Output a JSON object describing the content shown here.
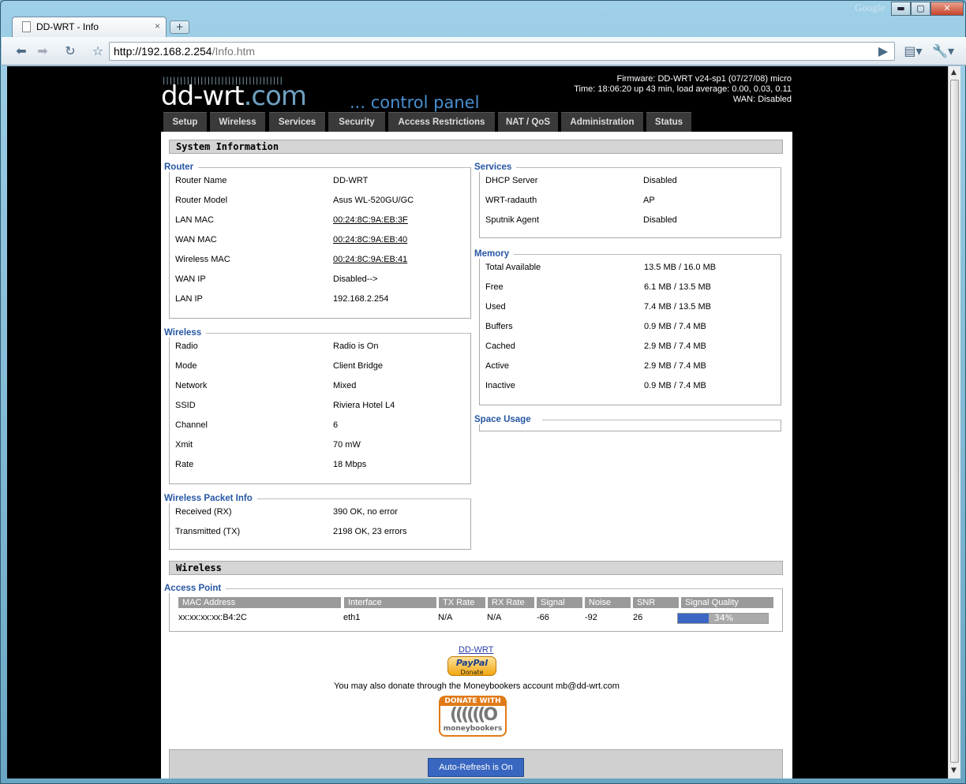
{
  "browser": {
    "tab_title": "DD-WRT - Info",
    "tab_close": "×",
    "new_tab": "+",
    "brand": "Google",
    "url_host": "http://192.168.2.254",
    "url_path": "/Info.htm"
  },
  "header": {
    "logo_main": "dd-wrt",
    "logo_suffix": ".com",
    "control_panel": "... control panel",
    "firmware": "Firmware: DD-WRT v24-sp1 (07/27/08) micro",
    "time": "Time: 18:06:20 up 43 min, load average: 0.00, 0.03, 0.11",
    "wan": "WAN: Disabled"
  },
  "nav": [
    "Setup",
    "Wireless",
    "Services",
    "Security",
    "Access Restrictions",
    "NAT / QoS",
    "Administration",
    "Status"
  ],
  "system_info_title": "System Information",
  "router": {
    "legend": "Router",
    "rows": [
      {
        "label": "Router Name",
        "value": "DD-WRT"
      },
      {
        "label": "Router Model",
        "value": "Asus WL-520GU/GC"
      },
      {
        "label": "LAN MAC",
        "value": "00:24:8C:9A:EB:3F"
      },
      {
        "label": "WAN MAC",
        "value": "00:24:8C:9A:EB:40"
      },
      {
        "label": "Wireless MAC",
        "value": "00:24:8C:9A:EB:41"
      },
      {
        "label": "WAN IP",
        "value": "Disabled-->"
      },
      {
        "label": "LAN IP",
        "value": "192.168.2.254"
      }
    ]
  },
  "wireless": {
    "legend": "Wireless",
    "rows": [
      {
        "label": "Radio",
        "value": "Radio is On"
      },
      {
        "label": "Mode",
        "value": "Client Bridge"
      },
      {
        "label": "Network",
        "value": "Mixed"
      },
      {
        "label": "SSID",
        "value": "Riviera Hotel L4"
      },
      {
        "label": "Channel",
        "value": "6"
      },
      {
        "label": "Xmit",
        "value": "70 mW"
      },
      {
        "label": "Rate",
        "value": "18 Mbps"
      }
    ]
  },
  "packet": {
    "legend": "Wireless Packet Info",
    "rows": [
      {
        "label": "Received (RX)",
        "value": "390 OK, no error"
      },
      {
        "label": "Transmitted (TX)",
        "value": "2198 OK, 23 errors"
      }
    ]
  },
  "services": {
    "legend": "Services",
    "rows": [
      {
        "label": "DHCP Server",
        "value": "Disabled"
      },
      {
        "label": "WRT-radauth",
        "value": "AP"
      },
      {
        "label": "Sputnik Agent",
        "value": "Disabled"
      }
    ]
  },
  "memory": {
    "legend": "Memory",
    "rows": [
      {
        "label": "Total Available",
        "value": "13.5 MB / 16.0 MB"
      },
      {
        "label": "Free",
        "value": "6.1 MB / 13.5 MB"
      },
      {
        "label": "Used",
        "value": "7.4 MB / 13.5 MB"
      },
      {
        "label": "Buffers",
        "value": "0.9 MB / 7.4 MB"
      },
      {
        "label": "Cached",
        "value": "2.9 MB / 7.4 MB"
      },
      {
        "label": "Active",
        "value": "2.9 MB / 7.4 MB"
      },
      {
        "label": "Inactive",
        "value": "0.9 MB / 7.4 MB"
      }
    ]
  },
  "space_usage": {
    "legend": "Space Usage"
  },
  "wireless_section_title": "Wireless",
  "access_point": {
    "legend": "Access Point",
    "headers": [
      "MAC Address",
      "Interface",
      "TX Rate",
      "RX Rate",
      "Signal",
      "Noise",
      "SNR",
      "Signal Quality"
    ],
    "row": [
      "xx:xx:xx:xx:B4:2C",
      "eth1",
      "N/A",
      "N/A",
      "-66",
      "-92",
      "26"
    ],
    "quality_label": "34%",
    "quality_fraction": 0.34
  },
  "donate": {
    "ddwrt_label": "DD-WRT",
    "paypal_label": "PayPal",
    "paypal_sub": "Donate",
    "moneybookers_text": "You may also donate through the Moneybookers account mb@dd-wrt.com",
    "mb_top": "DONATE WITH",
    "mb_ring": "((((((O",
    "mb_name": "moneybookers"
  },
  "auto_refresh": "Auto-Refresh is On"
}
